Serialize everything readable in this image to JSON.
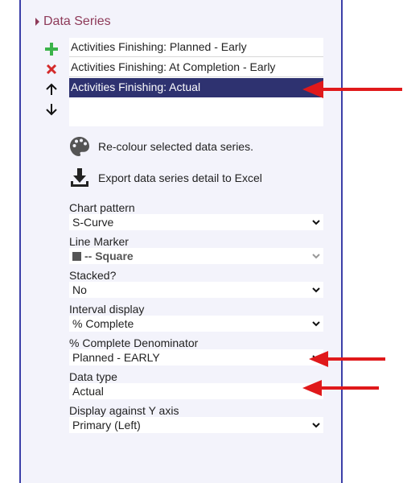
{
  "section": {
    "title": "Data Series"
  },
  "series_list": [
    "Activities Finishing: Planned - Early",
    "Activities Finishing: At Completion - Early",
    "Activities Finishing: Actual"
  ],
  "tools": {
    "recolour_label": "Re-colour selected data series.",
    "export_label": "Export data series detail to Excel"
  },
  "fields": {
    "chart_pattern": {
      "label": "Chart pattern",
      "value": "S-Curve"
    },
    "line_marker": {
      "label": "Line Marker",
      "value": "-- Square"
    },
    "stacked": {
      "label": "Stacked?",
      "value": "No"
    },
    "interval": {
      "label": "Interval display",
      "value": "% Complete"
    },
    "denominator": {
      "label": "% Complete Denominator",
      "value": "Planned - EARLY"
    },
    "data_type": {
      "label": "Data type",
      "value": "Actual"
    },
    "y_axis": {
      "label": "Display against Y axis",
      "value": "Primary (Left)"
    }
  },
  "colors": {
    "accent": "#8e3a59",
    "selected": "#2e3270",
    "arrow": "#e0191b",
    "add": "#3bb34a",
    "delete": "#d42a2a"
  }
}
